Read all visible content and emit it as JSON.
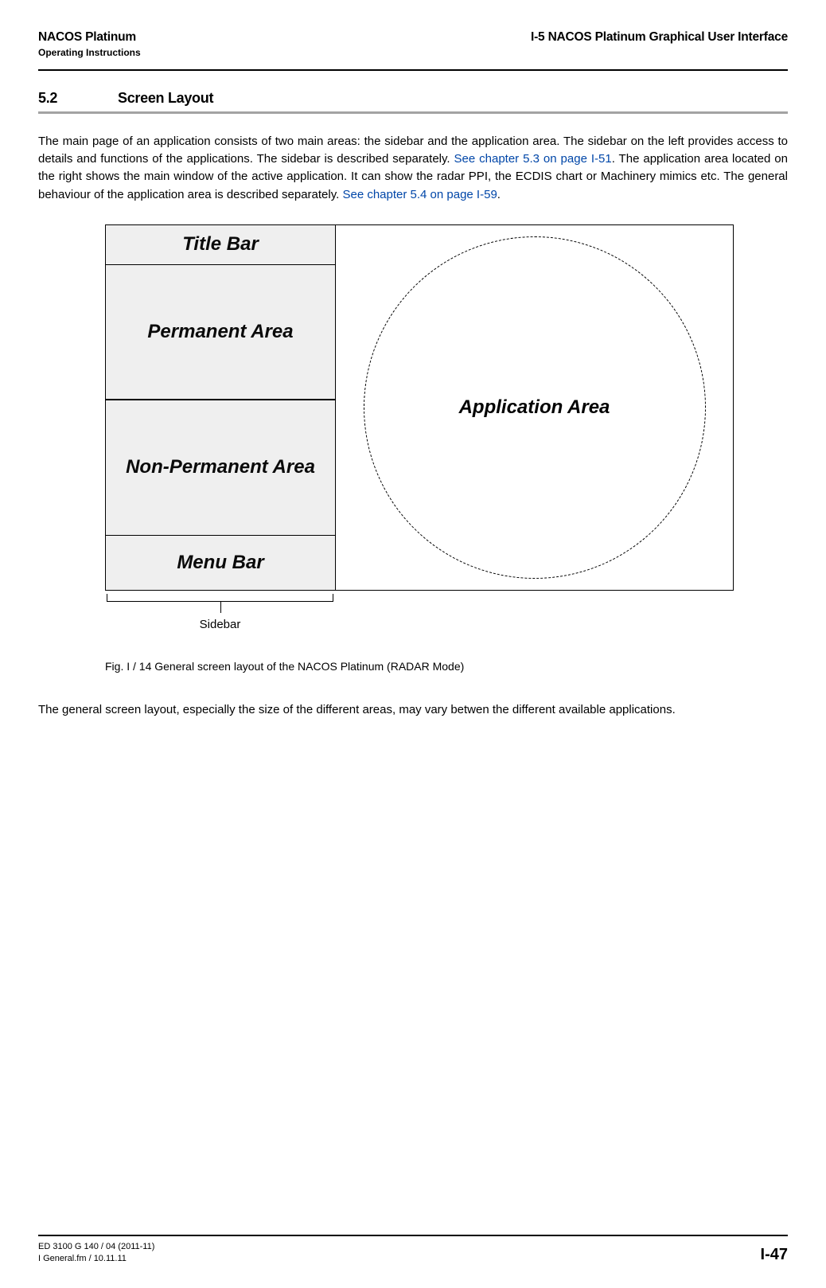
{
  "header": {
    "left_title": "NACOS Platinum",
    "left_sub": "Operating Instructions",
    "right_title": "I-5  NACOS Platinum Graphical User Interface"
  },
  "section": {
    "number": "5.2",
    "title": "Screen Layout"
  },
  "para1": {
    "t1": "The main page of an application consists of two main areas: the sidebar and the application area. The sidebar on the left provides access to details and functions of the applications. The sidebar is described separately. ",
    "x1": "See chapter 5.3 on page I-51",
    "t2": ". The application area located on the right shows the main window of the active application. It can show the radar PPI, the ECDIS chart or Machinery mimics etc. The general behaviour of the application area is described separately. ",
    "x2": "See chapter 5.4 on page I-59",
    "t3": "."
  },
  "diagram": {
    "title_bar": "Title Bar",
    "permanent": "Permanent Area",
    "non_permanent": "Non-Permanent Area",
    "menu_bar": "Menu Bar",
    "application": "Application Area",
    "sidebar_label": "Sidebar"
  },
  "figure_caption": "Fig. I /  14    General screen layout of the NACOS Platinum (RADAR Mode)",
  "para2": "The general screen layout, especially the size of the different areas, may vary betwen the different available applications.",
  "footer": {
    "l1": "ED 3100 G 140 / 04 (2011-11)",
    "l2": "I General.fm / 10.11.11",
    "page": "I-47"
  }
}
